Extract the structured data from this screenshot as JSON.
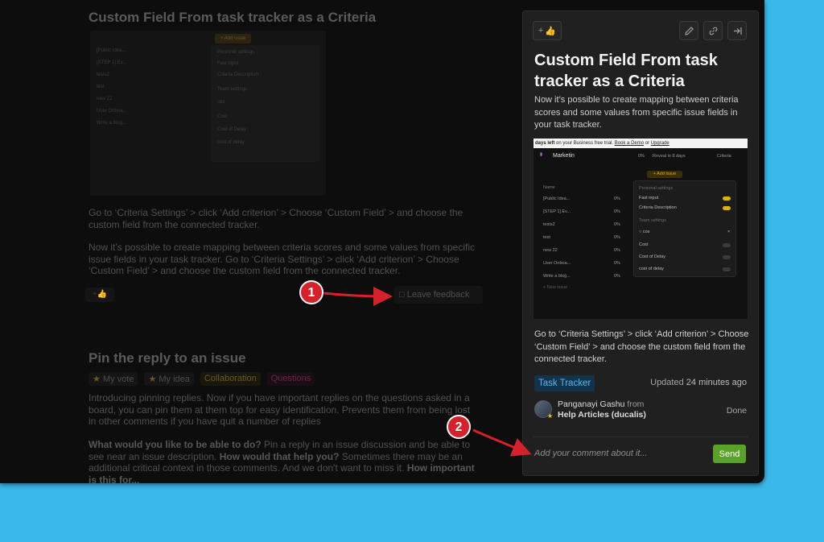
{
  "feed": {
    "item1": {
      "title": "Custom Field From task tracker as a Criteria",
      "how_to": "Go to ‘Criteria Settings’ > click ‘Add criterion’ > Choose ‘Custom Field’ > and choose the custom field from the connected tracker.",
      "body": "Now it’s possible to create mapping between criteria scores and some values from specific issue fields in your task tracker. Go to ‘Criteria Settings’ > click ‘Add criterion’ > Choose ‘Custom Field’ > and choose the custom field from the connected tracker.",
      "leave_feedback": "Leave feedback"
    },
    "item2": {
      "title": "Pin the reply to an issue",
      "tags": [
        "My vote",
        "My idea",
        "Collaboration",
        "Questions"
      ],
      "body": "Introducing pinning replies. Now if you have important replies on the questions asked in a board, you can pin them at them top for easy identification. Prevents them from being lost in other comments if you have quit a number of replies",
      "q1": "What would you like to be able to do?",
      "a1": " Pin a reply in an issue discussion and be able to see near an issue description. ",
      "q2": "How would that help you?",
      "a2": " Sometimes there may be an additional critical context in those comments. And we don't want to miss it. ",
      "q3": "How important is this for..."
    },
    "small_shot": {
      "add_issue": "+ Add issue",
      "rows": [
        "[Public Idea...",
        "[STEP 1] Ev...",
        "tests2",
        "test",
        "new 22",
        "User Onboa...",
        "Write a blog..."
      ],
      "popup": [
        "Personal settings",
        "Fast input",
        "Criteria Description",
        "Team settings",
        "cos",
        "Cost",
        "Cost of Delay",
        "cost of delay"
      ]
    }
  },
  "panel": {
    "title": "Custom Field From task tracker as a Criteria",
    "description": "Now it’s possible to create mapping between criteria scores and some values from specific issue fields in your task tracker.",
    "screenshot": {
      "trial_prefix": "days left",
      "trial_middle": " on your Business free trial. ",
      "book_demo": "Book a Demo",
      "or": " or ",
      "upgrade": "Upgrade",
      "board": "Marketin",
      "zero_pct": "0%",
      "reveal": "Reveal in 8 days",
      "criteria": "Criteria",
      "add_issue": "+ Add issue",
      "col_name": "Name",
      "rows": [
        "[Public Idea...",
        "[STEP 1] Ev...",
        "tests2",
        "test",
        "new 22",
        "User Onboa...",
        "Write a blog..."
      ],
      "row_pct": "0%",
      "new_issue": "+ New issue",
      "personal_settings": "Personal settings",
      "fast_input": "Fast input",
      "criteria_description": "Criteria Description",
      "team_settings": "Team settings",
      "search_value": "cos",
      "opt_cost": "Cost",
      "opt_cost_of_delay": "Cost of Delay",
      "opt_cost_of_delay_lower": "cost of delay"
    },
    "how_to": "Go to ‘Criteria Settings’ > click ‘Add criterion’ > Choose ‘Custom Field’ > and choose the custom field from the connected tracker.",
    "chip": "Task Tracker",
    "updated_prefix": "Updated ",
    "updated_value": "24 minutes ago",
    "author_name": "Panganayi Gashu",
    "author_from": " from",
    "author_board": "Help Articles (ducalis)",
    "status": "Done",
    "comment_placeholder": "Add your comment about it...",
    "send_label": "Send"
  },
  "annotations": {
    "badge1": "1",
    "badge2": "2"
  },
  "colors": {
    "accent_green": "#5aa12a",
    "chip_blue": "#57b6ef",
    "annotation_red": "#d6202a",
    "background_blue": "#3bb8ea"
  }
}
